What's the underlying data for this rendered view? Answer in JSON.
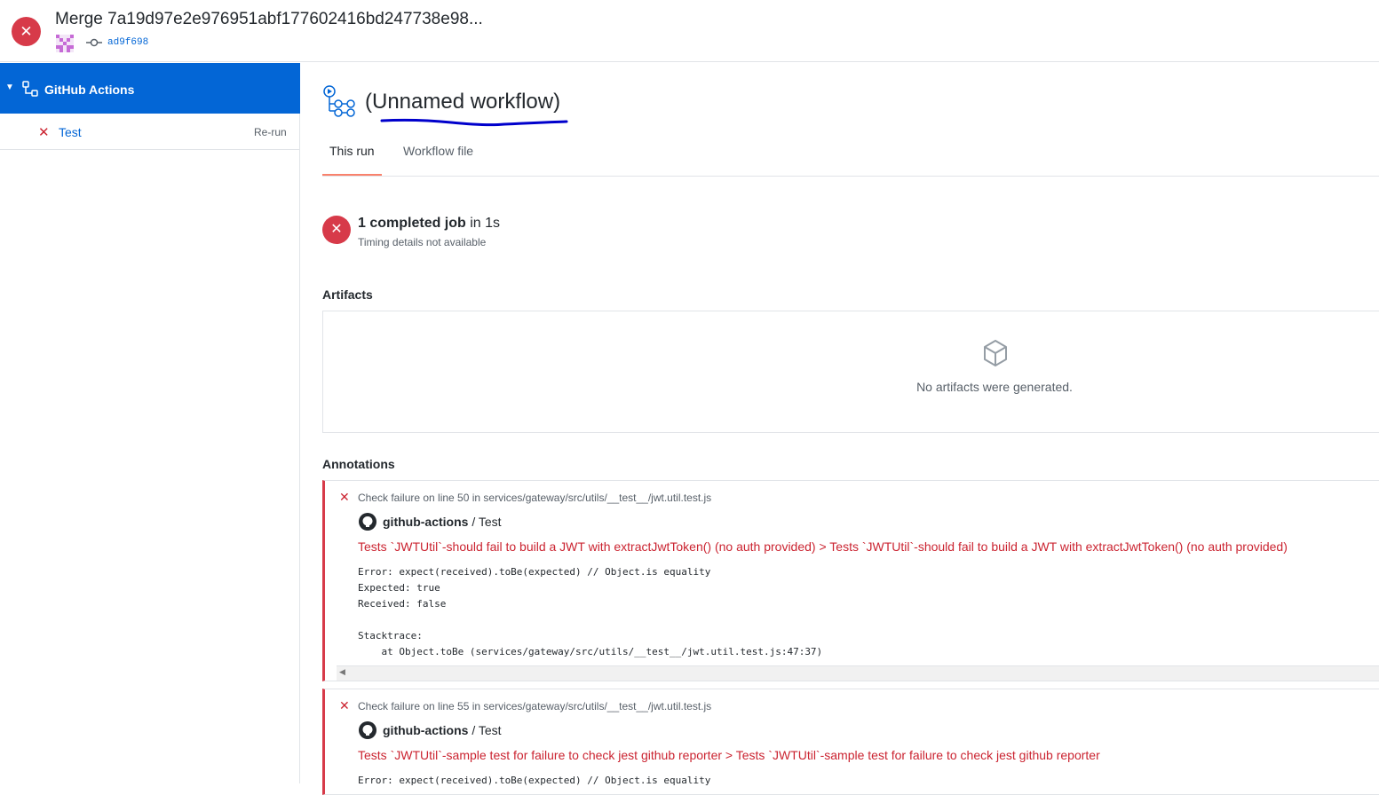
{
  "header": {
    "status_icon": "x-circle-icon",
    "commit_title": "Merge 7a19d97e2e976951abf177602416bd247738e98...",
    "sha": "ad9f698"
  },
  "sidebar": {
    "workflow_name": "GitHub Actions",
    "job": {
      "name": "Test",
      "rerun_label": "Re-run"
    }
  },
  "main": {
    "workflow_title": "(Unnamed workflow)",
    "tabs": [
      {
        "label": "This run",
        "active": true
      },
      {
        "label": "Workflow file",
        "active": false
      }
    ],
    "summary": {
      "count_text": "1 completed job",
      "in_text": " in 1s",
      "timing": "Timing details not available"
    },
    "artifacts": {
      "title": "Artifacts",
      "empty_text": "No artifacts were generated."
    },
    "annotations": {
      "title": "Annotations",
      "items": [
        {
          "location": "Check failure on line 50 in services/gateway/src/utils/__test__/jwt.util.test.js",
          "source_bold": "github-actions",
          "source_rest": " / Test",
          "title": "Tests `JWTUtil`-should fail to build a JWT with extractJwtToken() (no auth provided) > Tests `JWTUtil`-should fail to build a JWT with extractJwtToken() (no auth provided)",
          "body": "Error: expect(received).toBe(expected) // Object.is equality\nExpected: true\nReceived: false\n\nStacktrace:\n    at Object.toBe (services/gateway/src/utils/__test__/jwt.util.test.js:47:37)"
        },
        {
          "location": "Check failure on line 55 in services/gateway/src/utils/__test__/jwt.util.test.js",
          "source_bold": "github-actions",
          "source_rest": " / Test",
          "title": "Tests `JWTUtil`-sample test for failure to check jest github reporter > Tests `JWTUtil`-sample test for failure to check jest github reporter",
          "body": "Error: expect(received).toBe(expected) // Object.is equality"
        }
      ]
    }
  },
  "colors": {
    "accent_blue": "#0366d6",
    "failure_red": "#d73a49",
    "tab_underline": "#f9826c"
  }
}
